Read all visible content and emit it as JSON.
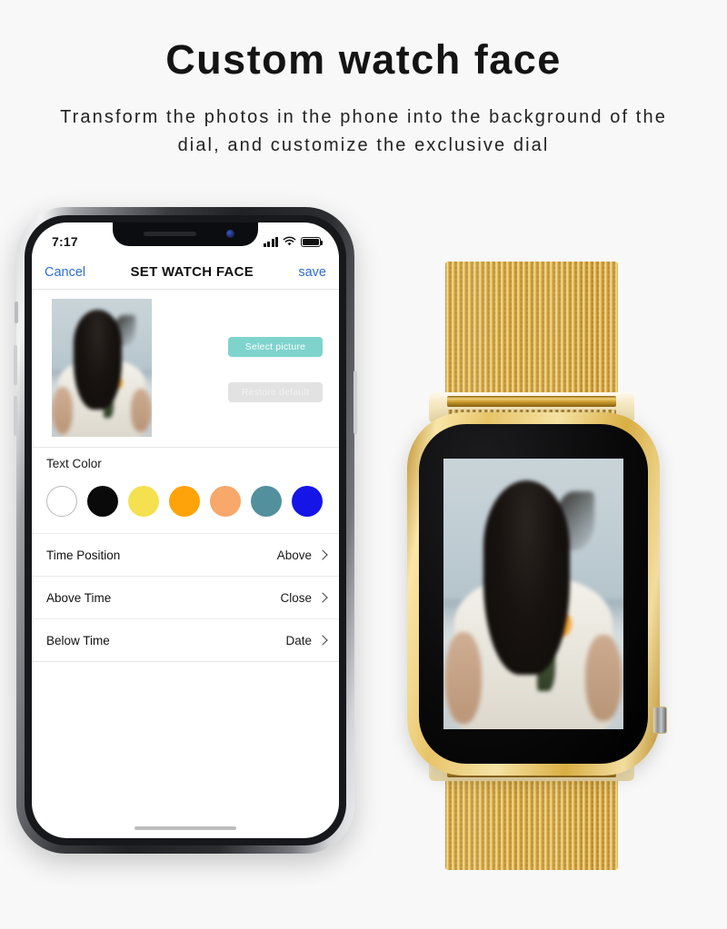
{
  "header": {
    "title": "Custom watch face",
    "subtitle": "Transform the photos in the phone into the background of the dial, and customize the exclusive dial"
  },
  "phone": {
    "status_bar": {
      "time": "7:17",
      "signal_icon": "signal-bars-icon",
      "wifi_icon": "wifi-icon",
      "battery_icon": "battery-full-icon"
    },
    "nav_bar": {
      "cancel_label": "Cancel",
      "title": "SET WATCH FACE",
      "save_label": "save"
    },
    "preview": {
      "select_picture_label": "Select picture",
      "restore_default_label": "Restore default",
      "select_button_color": "#7ed4cd",
      "restore_button_color": "#e2e2e2"
    },
    "text_color": {
      "label": "Text Color",
      "swatches": [
        {
          "name": "white",
          "hex": "#ffffff",
          "selected": true
        },
        {
          "name": "black",
          "hex": "#0a0a0a",
          "selected": false
        },
        {
          "name": "yellow",
          "hex": "#f5e04f",
          "selected": false
        },
        {
          "name": "orange",
          "hex": "#ffa30a",
          "selected": false
        },
        {
          "name": "peach",
          "hex": "#f7a86a",
          "selected": false
        },
        {
          "name": "teal",
          "hex": "#53909e",
          "selected": false
        },
        {
          "name": "blue",
          "hex": "#1515e8",
          "selected": false
        }
      ]
    },
    "settings": [
      {
        "label": "Time Position",
        "value": "Above",
        "chevron": "chevron-right-icon"
      },
      {
        "label": "Above Time",
        "value": "Close",
        "chevron": "chevron-right-icon"
      },
      {
        "label": "Below Time",
        "value": "Date",
        "chevron": "chevron-right-icon"
      }
    ]
  },
  "watch": {
    "band_color": "#e4bf62",
    "case_color": "#e7c469",
    "screen_color": "#000000"
  }
}
